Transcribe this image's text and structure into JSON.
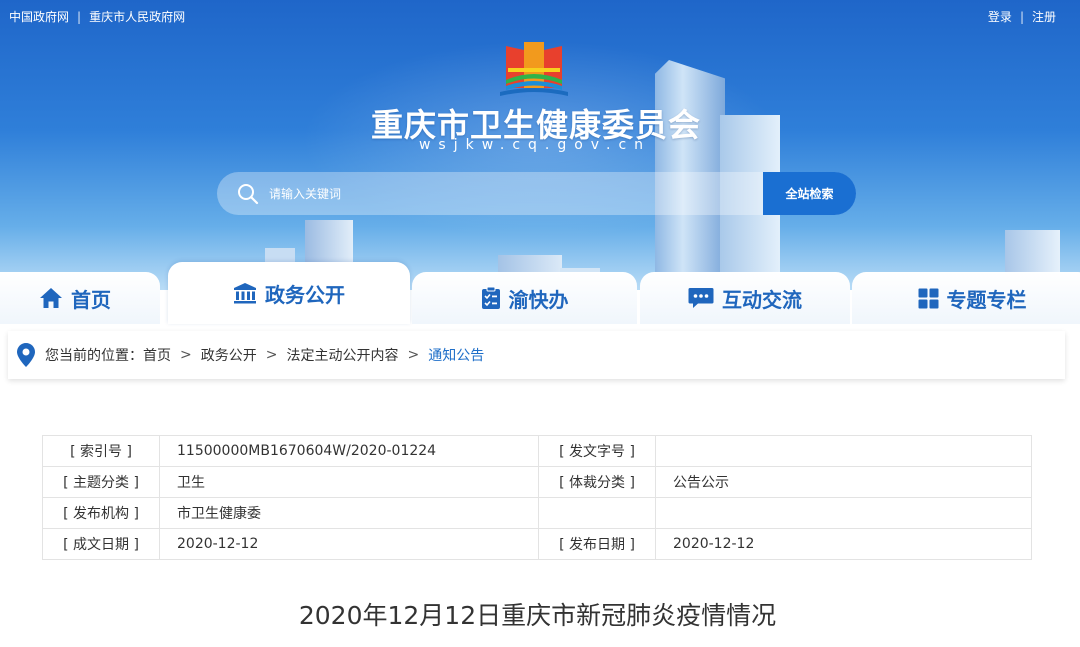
{
  "topbar": {
    "links_left": [
      "中国政府网",
      "重庆市人民政府网"
    ],
    "login": "登录",
    "register": "注册",
    "separator": "|"
  },
  "header": {
    "title": "重庆市卫生健康委员会",
    "domain": "wsjkw.cq.gov.cn"
  },
  "search": {
    "placeholder": "请输入关键词",
    "button": "全站检索"
  },
  "nav": {
    "items": [
      {
        "label": "首页",
        "icon": "home-icon"
      },
      {
        "label": "政务公开",
        "icon": "government-building-icon"
      },
      {
        "label": "渝快办",
        "icon": "checklist-icon"
      },
      {
        "label": "互动交流",
        "icon": "chat-bubble-icon"
      },
      {
        "label": "专题专栏",
        "icon": "grid-icon"
      }
    ],
    "active_index": 1
  },
  "breadcrumb": {
    "prefix": "您当前的位置：",
    "items": [
      "首页",
      "政务公开",
      "法定主动公开内容",
      "通知公告"
    ],
    "separator": ">"
  },
  "meta": {
    "rows": [
      {
        "k1": "[ 索引号 ]",
        "v1": "11500000MB1670604W/2020-01224",
        "k2": "[ 发文字号 ]",
        "v2": ""
      },
      {
        "k1": "[ 主题分类 ]",
        "v1": "卫生",
        "k2": "[ 体裁分类 ]",
        "v2": "公告公示"
      },
      {
        "k1": "[ 发布机构 ]",
        "v1": "市卫生健康委",
        "k2": "",
        "v2": ""
      },
      {
        "k1": "[ 成文日期 ]",
        "v1": "2020-12-12",
        "k2": "[ 发布日期 ]",
        "v2": "2020-12-12"
      }
    ]
  },
  "article": {
    "title": "2020年12月12日重庆市新冠肺炎疫情情况"
  },
  "colors": {
    "brand_blue": "#1f66bd",
    "button_blue": "#1a6fd2",
    "crumb_current": "#1f6fc9"
  }
}
